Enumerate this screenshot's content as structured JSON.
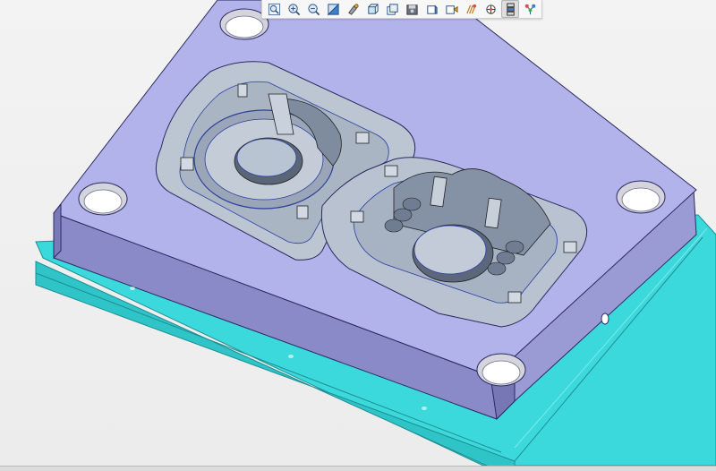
{
  "window": {
    "kind": "3d-cad-viewport"
  },
  "toolbar": {
    "buttons": [
      {
        "icon": "zoom-fit-icon"
      },
      {
        "icon": "zoom-in-icon"
      },
      {
        "icon": "zoom-out-icon"
      },
      {
        "icon": "pan-view-icon"
      },
      {
        "icon": "repaint-icon"
      },
      {
        "icon": "display-style-icon"
      },
      {
        "icon": "layer-icon"
      },
      {
        "icon": "saved-views-icon"
      },
      {
        "icon": "view-manager-icon"
      },
      {
        "icon": "datum-display-icon"
      },
      {
        "icon": "spin-center-icon"
      },
      {
        "icon": "annotation-display-icon"
      },
      {
        "icon": "model-tree-icon",
        "active": true
      },
      {
        "icon": "network-icon"
      }
    ]
  },
  "colors": {
    "plate_top": "#b3b3eb",
    "plate_side": "#9595d2",
    "plate_front": "#8585c4",
    "cavity": "#b7c2d0",
    "cavity_dark": "#8997aa",
    "base_plate": "#3cd9dc",
    "base_plate_dark": "#1fb3b8",
    "edge_blue": "#2a3fa0"
  }
}
